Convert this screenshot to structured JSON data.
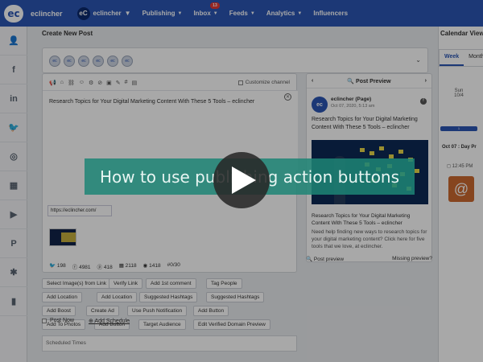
{
  "topbar": {
    "brand": "eclincher",
    "account_name": "eclincher",
    "account_logo": "eC",
    "nav": [
      {
        "label": "Publishing",
        "chevron": true
      },
      {
        "label": "Inbox",
        "chevron": true,
        "badge": "13"
      },
      {
        "label": "Feeds",
        "chevron": true
      },
      {
        "label": "Analytics",
        "chevron": true
      },
      {
        "label": "Influencers",
        "chevron": false
      }
    ]
  },
  "sidebar": {
    "icons": [
      "add-user-icon",
      "facebook-icon",
      "linkedin-icon",
      "twitter-icon",
      "instagram-icon",
      "store-icon",
      "youtube-icon",
      "pinterest-icon",
      "yelp-icon",
      "analytics-icon"
    ]
  },
  "create_post": {
    "title": "Create New Post",
    "customize_channel": "Customize channel",
    "post_text": "Research Topics for Your Digital Marketing Content With These 5 Tools – eclincher",
    "link_text": "https://eclincher.com/",
    "stats": [
      {
        "icon": "twitter-icon",
        "value": "198"
      },
      {
        "icon": "facebook-icon",
        "value": "4981"
      },
      {
        "icon": "pinterest-icon",
        "value": "418"
      },
      {
        "icon": "grid-icon",
        "value": "2118"
      },
      {
        "icon": "circle-icon",
        "value": "1418"
      },
      {
        "icon": "gmb-icon",
        "value": "#0/30"
      }
    ]
  },
  "action_buttons": [
    {
      "label": "Select Image(s) from Link"
    },
    {
      "label": "Verify Link"
    },
    {
      "label": "Add 1st comment"
    },
    {
      "label": "Tag People"
    },
    {
      "label": "Add Location"
    },
    {
      "label": "Add Location"
    },
    {
      "label": "Suggested Hashtags"
    },
    {
      "label": "Suggested Hashtags"
    },
    {
      "label": "Add Boost"
    },
    {
      "label": "Create Ad"
    },
    {
      "label": "Use Push Notification"
    },
    {
      "label": "Add Button"
    },
    {
      "label": "Add To Photos"
    },
    {
      "label": "Add Button"
    },
    {
      "label": "Target Audience"
    },
    {
      "label": "Edit Verified Domain Preview"
    }
  ],
  "schedule": {
    "post_now": "Post Now",
    "add_schedule": "Add Schedule",
    "scheduled_times": "Scheduled Times"
  },
  "preview": {
    "title": "Post Preview",
    "page_name": "eclincher (Page)",
    "date": "Oct 07, 2020, 5:13 am",
    "text": "Research Topics for Your Digital Marketing Content With These 5 Tools – eclincher",
    "link_title": "Research Topics for Your Digital Marketing Content With These 5 Tools – eclincher",
    "link_desc": "Need help finding new ways to research topics for your digital marketing content? Click here for five tools that we love, at eclincher.",
    "post_preview": "Post preview",
    "missing_preview": "Missing preview?"
  },
  "calendar": {
    "title": "Calendar View",
    "tabs": [
      "Week",
      "Month"
    ],
    "day_name": "Sun",
    "day_date": "10/4",
    "bar_value": "1",
    "day_header": "Oct 07 : Day Pr",
    "time": "12:45 PM"
  },
  "video_overlay": {
    "banner_text": "How to use publishing action buttons"
  }
}
